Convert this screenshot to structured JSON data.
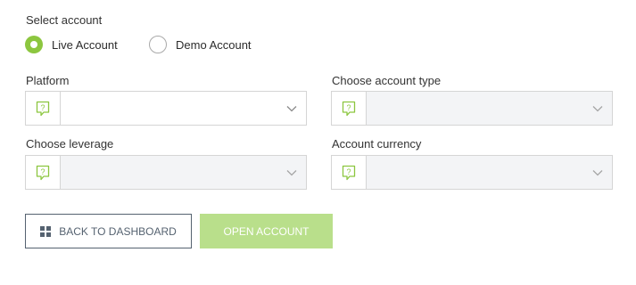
{
  "account_select": {
    "label": "Select account",
    "options": [
      {
        "label": "Live Account",
        "selected": true
      },
      {
        "label": "Demo Account",
        "selected": false
      }
    ]
  },
  "fields": {
    "platform": {
      "label": "Platform",
      "value": "",
      "enabled": true
    },
    "account_type": {
      "label": "Choose account type",
      "value": "",
      "enabled": false
    },
    "leverage": {
      "label": "Choose leverage",
      "value": "",
      "enabled": false
    },
    "currency": {
      "label": "Account currency",
      "value": "",
      "enabled": false
    }
  },
  "buttons": {
    "back": {
      "label": "BACK TO DASHBOARD",
      "icon": "grid-icon"
    },
    "open": {
      "label": "OPEN ACCOUNT"
    }
  },
  "icons": {
    "help": "help-question-icon",
    "dropdown": "chevron-down-icon"
  },
  "colors": {
    "accent": "#8cc63f",
    "accent_light": "#b9df8b",
    "dark_button": "#556270",
    "border": "#d5d5d5",
    "disabled_bg": "#f3f4f6"
  }
}
